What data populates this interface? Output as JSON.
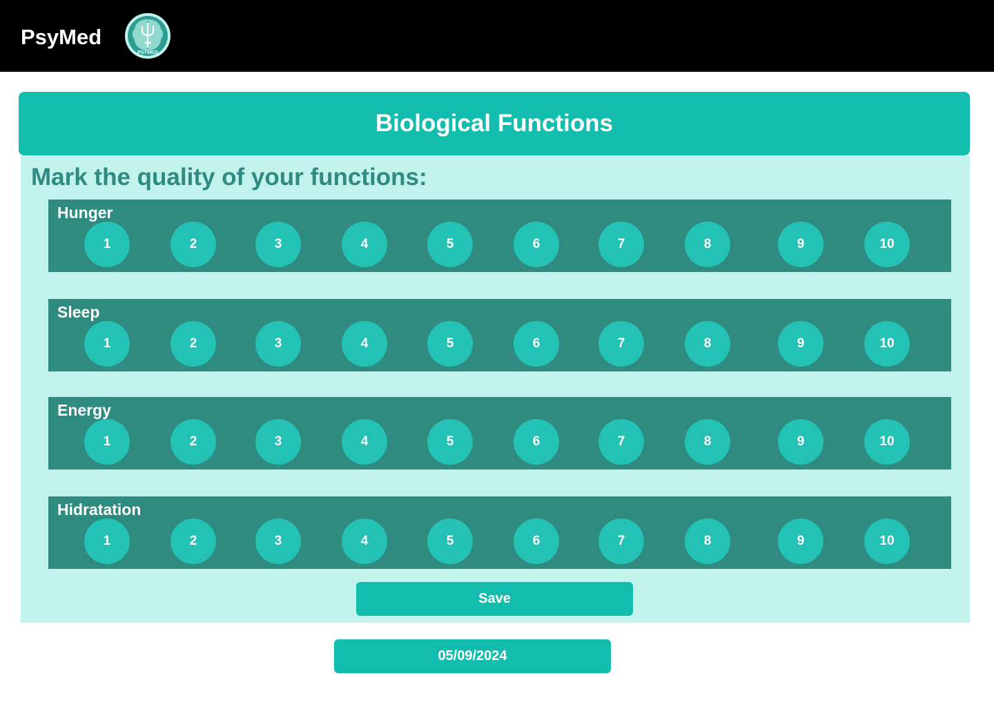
{
  "app": {
    "brand": "PsyMed",
    "logo_icon": "brain-psi-logo-icon",
    "logo_text": "PSYMED"
  },
  "colors": {
    "topbar": "#000000",
    "accent": "#12bdad",
    "panel": "#c1f2ec",
    "row": "#2f8a80",
    "option": "#24c2b4",
    "subtitle": "#2f8a80"
  },
  "header": {
    "title": "Biological Functions"
  },
  "form": {
    "prompt": "Mark the quality of your functions:",
    "scale": [
      "1",
      "2",
      "3",
      "4",
      "5",
      "6",
      "7",
      "8",
      "9",
      "10"
    ],
    "functions": [
      {
        "label": "Hunger"
      },
      {
        "label": "Sleep"
      },
      {
        "label": "Energy"
      },
      {
        "label": "Hidratation"
      }
    ],
    "save_label": "Save"
  },
  "date": "05/09/2024"
}
